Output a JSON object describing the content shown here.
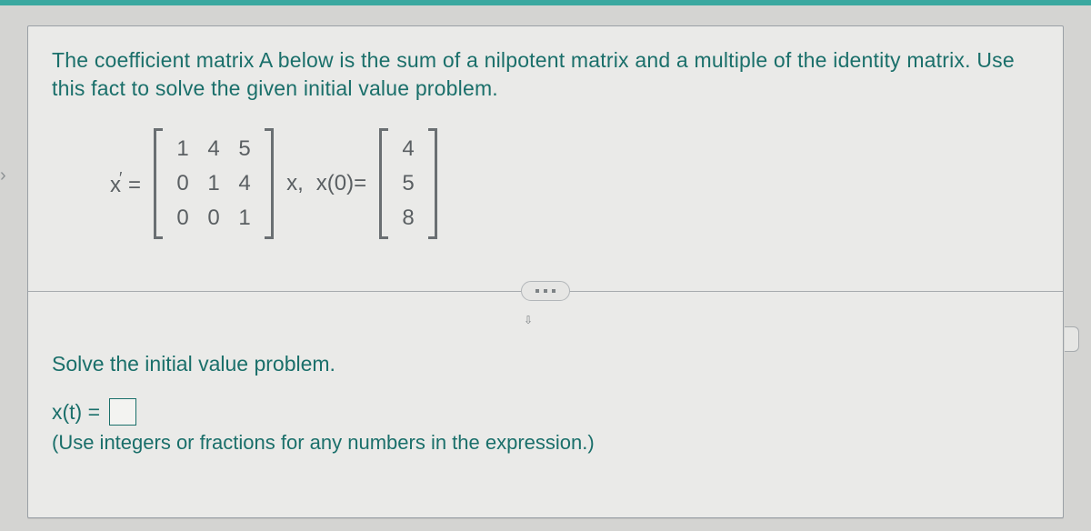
{
  "problem": {
    "intro": "The coefficient matrix A below is the sum of a nilpotent matrix and a multiple of the identity matrix. Use this fact to solve the given initial value problem.",
    "x_prime_label": "x",
    "equals": "=",
    "matrix_A": {
      "r0c0": "1",
      "r0c1": "4",
      "r0c2": "5",
      "r1c0": "0",
      "r1c1": "1",
      "r1c2": "4",
      "r2c0": "0",
      "r2c1": "0",
      "r2c2": "1"
    },
    "after_matrix_label": "x,",
    "x0_label": "x(0)=",
    "vector_x0": {
      "r0": "4",
      "r1": "5",
      "r2": "8"
    }
  },
  "section": {
    "solve_prompt": "Solve the initial value problem.",
    "answer_label": "x(t) =",
    "hint": "(Use integers or fractions for any numbers in the expression.)"
  }
}
